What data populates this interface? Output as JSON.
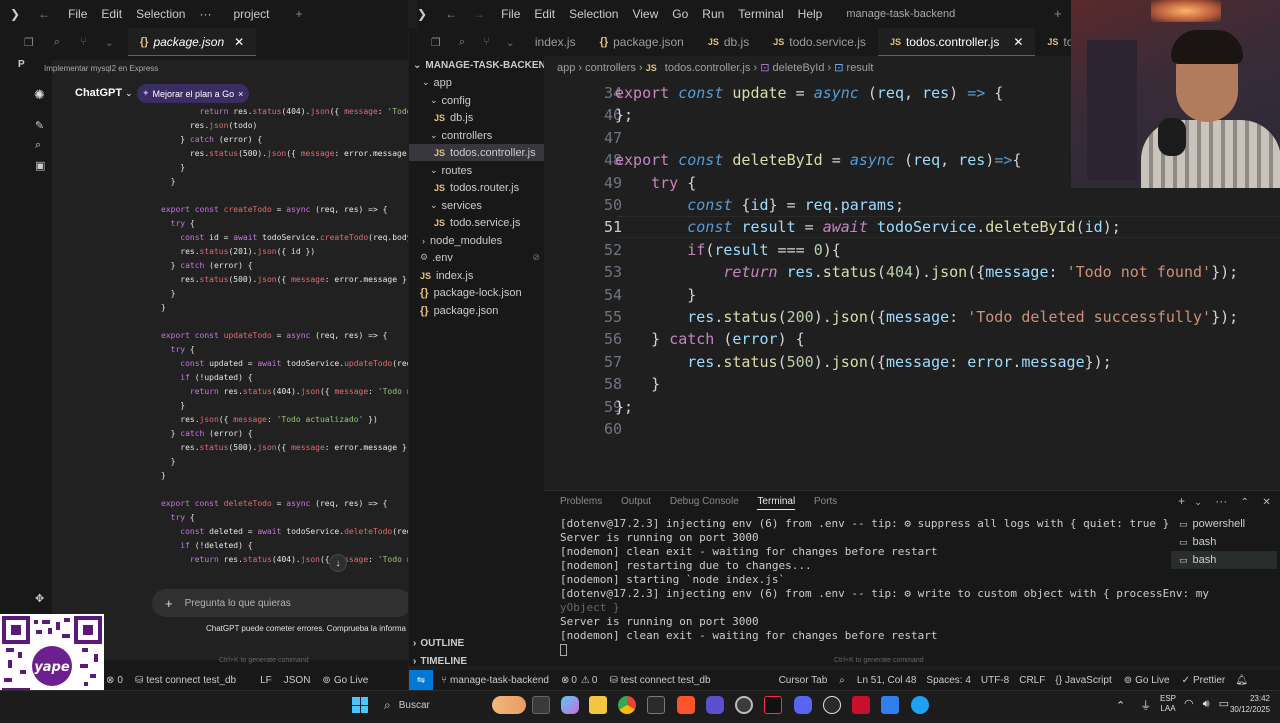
{
  "left_window": {
    "menu": [
      "File",
      "Edit",
      "Selection",
      "···"
    ],
    "title": "project",
    "tab": "package.json",
    "chat_header": "Implementar mysql2 en Express",
    "chat_app_name": "ChatGPT",
    "upgrade_button": "Mejorar el plan a Go",
    "input_placeholder": "Pregunta lo que quieras",
    "disclaimer": "ChatGPT puede cometer errores. Comprueba la informa",
    "hint": "Ctrl+K to generate command",
    "sidebar_letter": "P",
    "status": [
      "0",
      "test connect",
      "test_db",
      "LF",
      "JSON",
      "Go Live"
    ]
  },
  "right_window": {
    "menu": [
      "File",
      "Edit",
      "Selection",
      "View",
      "Go",
      "Run",
      "Terminal",
      "Help"
    ],
    "title": "manage-task-backend",
    "tabs": [
      {
        "label": "index.js",
        "badge": "JS"
      },
      {
        "label": "package.json",
        "badge": "{}"
      },
      {
        "label": "db.js",
        "badge": "JS"
      },
      {
        "label": "todo.service.js",
        "badge": "JS"
      },
      {
        "label": "todos.controller.js",
        "badge": "JS",
        "active": true
      },
      {
        "label": "todo",
        "badge": "JS"
      }
    ],
    "explorer_root": "MANAGE-TASK-BACKEND",
    "tree": [
      {
        "label": "app",
        "type": "folder"
      },
      {
        "label": "config",
        "type": "folder"
      },
      {
        "label": "db.js",
        "type": "js"
      },
      {
        "label": "controllers",
        "type": "folder"
      },
      {
        "label": "todos.controller.js",
        "type": "js",
        "selected": true
      },
      {
        "label": "routes",
        "type": "folder"
      },
      {
        "label": "todos.router.js",
        "type": "js"
      },
      {
        "label": "services",
        "type": "folder"
      },
      {
        "label": "todo.service.js",
        "type": "js"
      },
      {
        "label": "node_modules",
        "type": "folder"
      },
      {
        "label": ".env",
        "type": "env"
      },
      {
        "label": "index.js",
        "type": "js"
      },
      {
        "label": "package-lock.json",
        "type": "json"
      },
      {
        "label": "package.json",
        "type": "json"
      }
    ],
    "breadcrumb": [
      "app",
      "controllers",
      "todos.controller.js",
      "deleteById",
      "result"
    ],
    "line_numbers": [
      "34",
      "46",
      "47",
      "48",
      "49",
      "50",
      "51",
      "52",
      "53",
      "54",
      "55",
      "56",
      "57",
      "58",
      "59",
      "60"
    ],
    "outline": "OUTLINE",
    "timeline": "TIMELINE",
    "panel_tabs": [
      "Problems",
      "Output",
      "Debug Console",
      "Terminal",
      "Ports"
    ],
    "terminals": [
      "powershell",
      "bash",
      "bash"
    ],
    "terminal_lines": [
      "[dotenv@17.2.3] injecting env (6) from .env -- tip: ⚙ suppress all logs with { quiet: true }",
      "Server is running on port 3000",
      "[nodemon] clean exit - waiting for changes before restart",
      "[nodemon] restarting due to changes...",
      "[nodemon] starting `node index.js`",
      "[dotenv@17.2.3] injecting env (6) from .env -- tip: ⚙ write to custom object with { processEnv: my",
      "yObject }",
      "Server is running on port 3000",
      "[nodemon] clean exit - waiting for changes before restart"
    ],
    "hint": "Ctrl+K to generate command",
    "status": {
      "project": "manage-task-backend",
      "errors": "0",
      "warnings": "0",
      "items": [
        "test connect",
        "test_db"
      ],
      "cursor_tab": "Cursor Tab",
      "position": "Ln 51, Col 48",
      "spaces": "Spaces: 4",
      "encoding": "UTF-8",
      "eol": "CRLF",
      "language": "JavaScript",
      "golive": "Go Live",
      "prettier": "Prettier"
    }
  },
  "taskbar": {
    "search": "Buscar",
    "lang": "ESP",
    "region": "LAA",
    "time": "23:42",
    "date": "30/12/2025"
  }
}
